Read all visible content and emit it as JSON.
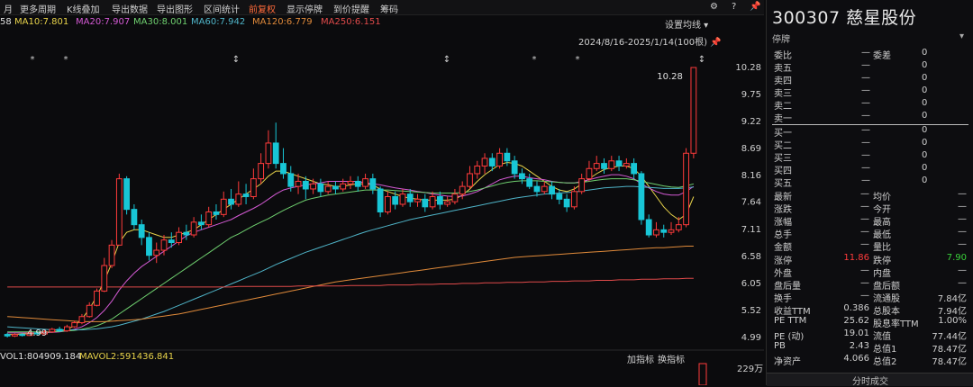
{
  "toolbar": {
    "items": [
      "月",
      "更多周期",
      "K线叠加",
      "导出数据",
      "导出图形",
      "区间统计",
      "前复权",
      "显示停牌",
      "到价提醒",
      "筹码"
    ],
    "active_index": 6,
    "settings_label": "设置均线",
    "date_range": "2024/8/16-2025/1/14(100根)"
  },
  "ma_labels": [
    {
      "text": "58",
      "color": "#e0e0e0"
    },
    {
      "text": "MA10:7.801",
      "color": "#e8d34a"
    },
    {
      "text": "MA20:7.907",
      "color": "#d45ad4"
    },
    {
      "text": "MA30:8.001",
      "color": "#6fd06f"
    },
    {
      "text": "MA60:7.942",
      "color": "#4fb4c8"
    },
    {
      "text": "MA120:6.779",
      "color": "#e08a3a"
    },
    {
      "text": "MA250:6.151",
      "color": "#e04a4a"
    }
  ],
  "chart_data": {
    "type": "candlestick",
    "y_ticks": [
      "10.28",
      "9.75",
      "9.22",
      "8.69",
      "8.16",
      "7.64",
      "7.11",
      "6.58",
      "6.05",
      "5.52",
      "4.99"
    ],
    "ylim": [
      4.99,
      10.28
    ],
    "high_label": "10.28",
    "low_label": "4.99",
    "candles": [
      [
        5.05,
        5.02,
        5.08,
        4.99
      ],
      [
        5.02,
        5.05,
        5.07,
        5.0
      ],
      [
        5.05,
        5.03,
        5.08,
        5.01
      ],
      [
        5.03,
        5.08,
        5.1,
        5.02
      ],
      [
        5.08,
        5.06,
        5.12,
        5.04
      ],
      [
        5.06,
        5.1,
        5.14,
        5.05
      ],
      [
        5.1,
        5.15,
        5.18,
        5.08
      ],
      [
        5.15,
        5.12,
        5.2,
        5.1
      ],
      [
        5.12,
        5.2,
        5.24,
        5.1
      ],
      [
        5.2,
        5.28,
        5.32,
        5.18
      ],
      [
        5.28,
        5.4,
        5.45,
        5.25
      ],
      [
        5.4,
        5.62,
        5.68,
        5.38
      ],
      [
        5.62,
        5.9,
        5.95,
        5.6
      ],
      [
        5.9,
        6.4,
        6.55,
        5.88
      ],
      [
        6.4,
        6.8,
        6.9,
        6.35
      ],
      [
        6.8,
        8.1,
        8.2,
        6.8
      ],
      [
        8.1,
        7.5,
        8.15,
        7.4
      ],
      [
        7.5,
        7.2,
        7.6,
        7.1
      ],
      [
        7.2,
        6.95,
        7.3,
        6.8
      ],
      [
        6.95,
        6.6,
        7.05,
        6.5
      ],
      [
        6.6,
        6.7,
        6.85,
        6.45
      ],
      [
        6.7,
        6.9,
        7.0,
        6.6
      ],
      [
        6.9,
        6.85,
        7.05,
        6.75
      ],
      [
        6.85,
        7.05,
        7.15,
        6.8
      ],
      [
        7.05,
        7.0,
        7.2,
        6.9
      ],
      [
        7.0,
        7.25,
        7.35,
        6.95
      ],
      [
        7.25,
        7.2,
        7.4,
        7.1
      ],
      [
        7.2,
        7.45,
        7.55,
        7.15
      ],
      [
        7.45,
        7.4,
        7.6,
        7.3
      ],
      [
        7.4,
        7.7,
        7.85,
        7.35
      ],
      [
        7.7,
        7.6,
        7.9,
        7.5
      ],
      [
        7.6,
        7.8,
        8.05,
        7.55
      ],
      [
        7.8,
        7.75,
        8.0,
        7.6
      ],
      [
        7.75,
        8.1,
        8.3,
        7.7
      ],
      [
        8.1,
        8.4,
        8.6,
        8.0
      ],
      [
        8.4,
        8.8,
        9.05,
        8.3
      ],
      [
        8.8,
        8.4,
        9.2,
        8.3
      ],
      [
        8.4,
        8.2,
        8.7,
        8.1
      ],
      [
        8.2,
        7.95,
        8.35,
        7.85
      ],
      [
        7.95,
        8.05,
        8.2,
        7.8
      ],
      [
        8.05,
        7.9,
        8.15,
        7.7
      ],
      [
        7.9,
        8.0,
        8.1,
        7.8
      ],
      [
        8.0,
        7.85,
        8.1,
        7.75
      ],
      [
        7.85,
        7.95,
        8.05,
        7.8
      ],
      [
        7.95,
        7.9,
        8.05,
        7.8
      ],
      [
        7.9,
        8.0,
        8.1,
        7.85
      ],
      [
        8.0,
        8.05,
        8.15,
        7.9
      ],
      [
        8.05,
        7.95,
        8.15,
        7.85
      ],
      [
        7.95,
        8.1,
        8.2,
        7.9
      ],
      [
        8.1,
        7.9,
        8.2,
        7.8
      ],
      [
        7.9,
        7.45,
        7.95,
        7.35
      ],
      [
        7.45,
        7.75,
        7.85,
        7.4
      ],
      [
        7.75,
        7.6,
        7.85,
        7.5
      ],
      [
        7.6,
        7.8,
        7.9,
        7.55
      ],
      [
        7.8,
        7.65,
        7.9,
        7.55
      ],
      [
        7.65,
        7.7,
        7.8,
        7.55
      ],
      [
        7.7,
        7.55,
        7.8,
        7.45
      ],
      [
        7.55,
        7.75,
        7.85,
        7.5
      ],
      [
        7.75,
        7.6,
        7.85,
        7.5
      ],
      [
        7.6,
        7.65,
        7.75,
        7.55
      ],
      [
        7.65,
        7.8,
        7.9,
        7.6
      ],
      [
        7.8,
        7.95,
        8.05,
        7.7
      ],
      [
        7.95,
        8.2,
        8.35,
        7.9
      ],
      [
        8.2,
        8.35,
        8.45,
        8.1
      ],
      [
        8.35,
        8.5,
        8.6,
        8.2
      ],
      [
        8.5,
        8.35,
        8.6,
        8.25
      ],
      [
        8.35,
        8.6,
        8.7,
        8.3
      ],
      [
        8.6,
        8.45,
        8.7,
        8.35
      ],
      [
        8.45,
        8.2,
        8.55,
        8.1
      ],
      [
        8.2,
        8.1,
        8.3,
        8.0
      ],
      [
        8.1,
        7.95,
        8.2,
        7.9
      ],
      [
        7.95,
        7.85,
        8.05,
        7.75
      ],
      [
        7.85,
        7.95,
        8.05,
        7.8
      ],
      [
        7.95,
        7.8,
        8.05,
        7.7
      ],
      [
        7.8,
        7.7,
        7.9,
        7.6
      ],
      [
        7.7,
        7.55,
        7.8,
        7.45
      ],
      [
        7.55,
        7.85,
        7.95,
        7.5
      ],
      [
        7.85,
        8.1,
        8.2,
        7.8
      ],
      [
        8.1,
        8.3,
        8.45,
        8.05
      ],
      [
        8.3,
        8.4,
        8.55,
        8.25
      ],
      [
        8.4,
        8.3,
        8.5,
        8.2
      ],
      [
        8.3,
        8.45,
        8.55,
        8.25
      ],
      [
        8.45,
        8.35,
        8.55,
        8.25
      ],
      [
        8.35,
        8.4,
        8.5,
        8.3
      ],
      [
        8.4,
        8.2,
        8.5,
        8.1
      ],
      [
        8.2,
        7.3,
        8.25,
        7.2
      ],
      [
        7.3,
        7.0,
        7.4,
        6.95
      ],
      [
        7.0,
        7.1,
        7.25,
        6.95
      ],
      [
        7.1,
        7.05,
        7.2,
        6.95
      ],
      [
        7.05,
        7.1,
        7.25,
        7.0
      ],
      [
        7.1,
        7.2,
        7.35,
        7.05
      ],
      [
        7.2,
        8.6,
        8.7,
        7.15
      ],
      [
        8.6,
        10.28,
        10.28,
        8.5
      ]
    ]
  },
  "ma_lines": [
    {
      "color": "#e8d34a",
      "values": [
        5.05,
        5.05,
        5.06,
        5.06,
        5.07,
        5.08,
        5.1,
        5.12,
        5.15,
        5.22,
        5.35,
        5.55,
        5.8,
        6.1,
        6.45,
        6.85,
        7.05,
        7.1,
        7.1,
        7.05,
        7.0,
        6.95,
        6.95,
        7.0,
        7.05,
        7.1,
        7.2,
        7.3,
        7.4,
        7.5,
        7.6,
        7.7,
        7.8,
        7.9,
        8.0,
        8.15,
        8.25,
        8.25,
        8.2,
        8.15,
        8.1,
        8.05,
        8.0,
        7.98,
        7.95,
        7.95,
        7.98,
        8.0,
        8.0,
        7.98,
        7.9,
        7.85,
        7.8,
        7.75,
        7.72,
        7.7,
        7.68,
        7.68,
        7.68,
        7.68,
        7.7,
        7.78,
        7.9,
        8.05,
        8.18,
        8.28,
        8.38,
        8.42,
        8.4,
        8.35,
        8.25,
        8.15,
        8.05,
        7.95,
        7.88,
        7.85,
        7.9,
        8.0,
        8.1,
        8.2,
        8.28,
        8.32,
        8.35,
        8.35,
        8.3,
        8.15,
        7.95,
        7.75,
        7.55,
        7.4,
        7.3,
        7.4,
        7.75
      ]
    },
    {
      "color": "#d45ad4",
      "values": [
        5.08,
        5.08,
        5.08,
        5.08,
        5.08,
        5.09,
        5.09,
        5.1,
        5.12,
        5.15,
        5.2,
        5.28,
        5.38,
        5.52,
        5.7,
        5.92,
        6.1,
        6.25,
        6.38,
        6.48,
        6.58,
        6.68,
        6.78,
        6.88,
        6.98,
        7.05,
        7.1,
        7.15,
        7.2,
        7.25,
        7.3,
        7.38,
        7.45,
        7.52,
        7.6,
        7.7,
        7.8,
        7.88,
        7.92,
        7.95,
        7.98,
        8.0,
        8.02,
        8.05,
        8.05,
        8.05,
        8.05,
        8.05,
        8.02,
        8.0,
        7.98,
        7.95,
        7.92,
        7.9,
        7.88,
        7.85,
        7.83,
        7.8,
        7.78,
        7.76,
        7.75,
        7.76,
        7.8,
        7.85,
        7.92,
        8.0,
        8.08,
        8.12,
        8.15,
        8.15,
        8.12,
        8.1,
        8.08,
        8.05,
        8.03,
        8.02,
        8.02,
        8.05,
        8.08,
        8.12,
        8.15,
        8.18,
        8.18,
        8.15,
        8.1,
        8.0,
        7.92,
        7.85,
        7.8,
        7.78,
        7.78,
        7.85,
        7.95
      ]
    },
    {
      "color": "#6fd06f",
      "values": [
        5.1,
        5.1,
        5.1,
        5.1,
        5.1,
        5.1,
        5.1,
        5.11,
        5.12,
        5.13,
        5.15,
        5.18,
        5.22,
        5.28,
        5.35,
        5.45,
        5.55,
        5.65,
        5.75,
        5.85,
        5.95,
        6.05,
        6.15,
        6.25,
        6.35,
        6.45,
        6.55,
        6.65,
        6.75,
        6.85,
        6.95,
        7.02,
        7.1,
        7.18,
        7.25,
        7.32,
        7.4,
        7.48,
        7.55,
        7.62,
        7.68,
        7.72,
        7.75,
        7.78,
        7.8,
        7.82,
        7.84,
        7.86,
        7.88,
        7.88,
        7.88,
        7.88,
        7.87,
        7.86,
        7.85,
        7.84,
        7.83,
        7.82,
        7.82,
        7.82,
        7.82,
        7.83,
        7.85,
        7.88,
        7.92,
        7.96,
        8.0,
        8.03,
        8.05,
        8.06,
        8.06,
        8.06,
        8.05,
        8.04,
        8.03,
        8.02,
        8.02,
        8.03,
        8.05,
        8.07,
        8.09,
        8.1,
        8.1,
        8.1,
        8.08,
        8.05,
        8.02,
        7.99,
        7.96,
        7.94,
        7.93,
        7.96,
        8.0
      ]
    },
    {
      "color": "#4fb4c8",
      "values": [
        5.2,
        5.19,
        5.18,
        5.17,
        5.16,
        5.15,
        5.14,
        5.14,
        5.14,
        5.14,
        5.14,
        5.15,
        5.16,
        5.18,
        5.2,
        5.23,
        5.27,
        5.31,
        5.35,
        5.4,
        5.45,
        5.5,
        5.56,
        5.62,
        5.68,
        5.74,
        5.8,
        5.86,
        5.92,
        5.98,
        6.04,
        6.1,
        6.16,
        6.22,
        6.28,
        6.35,
        6.42,
        6.48,
        6.54,
        6.6,
        6.66,
        6.71,
        6.76,
        6.81,
        6.86,
        6.91,
        6.96,
        7.01,
        7.06,
        7.1,
        7.14,
        7.18,
        7.22,
        7.26,
        7.3,
        7.33,
        7.36,
        7.39,
        7.42,
        7.45,
        7.48,
        7.51,
        7.54,
        7.57,
        7.6,
        7.63,
        7.66,
        7.69,
        7.72,
        7.74,
        7.76,
        7.78,
        7.8,
        7.81,
        7.82,
        7.83,
        7.84,
        7.86,
        7.88,
        7.9,
        7.92,
        7.93,
        7.94,
        7.95,
        7.95,
        7.94,
        7.93,
        7.92,
        7.91,
        7.91,
        7.91,
        7.92,
        7.94
      ]
    },
    {
      "color": "#e08a3a",
      "values": [
        5.4,
        5.39,
        5.38,
        5.37,
        5.36,
        5.35,
        5.34,
        5.33,
        5.32,
        5.31,
        5.3,
        5.3,
        5.3,
        5.3,
        5.31,
        5.32,
        5.33,
        5.34,
        5.35,
        5.37,
        5.39,
        5.41,
        5.43,
        5.45,
        5.48,
        5.51,
        5.54,
        5.57,
        5.6,
        5.63,
        5.66,
        5.69,
        5.72,
        5.75,
        5.78,
        5.81,
        5.84,
        5.87,
        5.9,
        5.93,
        5.96,
        5.99,
        6.02,
        6.05,
        6.08,
        6.1,
        6.12,
        6.14,
        6.16,
        6.18,
        6.2,
        6.22,
        6.24,
        6.26,
        6.28,
        6.3,
        6.32,
        6.34,
        6.36,
        6.38,
        6.4,
        6.42,
        6.44,
        6.46,
        6.48,
        6.5,
        6.52,
        6.54,
        6.56,
        6.57,
        6.58,
        6.59,
        6.6,
        6.61,
        6.62,
        6.63,
        6.64,
        6.65,
        6.66,
        6.67,
        6.68,
        6.69,
        6.7,
        6.71,
        6.72,
        6.73,
        6.74,
        6.75,
        6.75,
        6.76,
        6.77,
        6.78,
        6.78
      ]
    },
    {
      "color": "#e04a4a",
      "values": [
        5.98,
        5.98,
        5.98,
        5.98,
        5.98,
        5.98,
        5.98,
        5.98,
        5.98,
        5.98,
        5.98,
        5.98,
        5.98,
        5.98,
        5.98,
        5.98,
        5.98,
        5.98,
        5.98,
        5.98,
        5.98,
        5.98,
        5.98,
        5.98,
        5.98,
        5.98,
        5.98,
        5.98,
        5.98,
        5.98,
        5.98,
        5.99,
        5.99,
        5.99,
        5.99,
        5.99,
        5.99,
        5.99,
        5.99,
        6.0,
        6.0,
        6.0,
        6.0,
        6.0,
        6.0,
        6.0,
        6.01,
        6.01,
        6.01,
        6.01,
        6.01,
        6.02,
        6.02,
        6.02,
        6.02,
        6.03,
        6.03,
        6.03,
        6.04,
        6.04,
        6.04,
        6.05,
        6.05,
        6.05,
        6.06,
        6.06,
        6.06,
        6.07,
        6.07,
        6.07,
        6.08,
        6.08,
        6.08,
        6.09,
        6.09,
        6.09,
        6.1,
        6.1,
        6.1,
        6.11,
        6.11,
        6.11,
        6.12,
        6.12,
        6.12,
        6.13,
        6.13,
        6.13,
        6.14,
        6.14,
        6.14,
        6.15,
        6.15
      ]
    }
  ],
  "markers": {
    "star_label": "*",
    "arrow_label": "↕"
  },
  "volume": {
    "mavol1": "VOL1:804909.184",
    "mavol2": "MAVOL2:591436.841",
    "add_label": "加指标",
    "swap_label": "换指标",
    "scale": "229万"
  },
  "panel": {
    "title": "300307 慈星股份",
    "status": "停牌",
    "wei_bi_label": "委比",
    "wei_bi_value": "—",
    "wei_cha_label": "委差",
    "wei_cha_value": "0",
    "sell_levels": [
      {
        "label": "卖五",
        "price": "—",
        "vol": "0"
      },
      {
        "label": "卖四",
        "price": "—",
        "vol": "0"
      },
      {
        "label": "卖三",
        "price": "—",
        "vol": "0"
      },
      {
        "label": "卖二",
        "price": "—",
        "vol": "0"
      },
      {
        "label": "卖一",
        "price": "—",
        "vol": "0"
      }
    ],
    "buy_levels": [
      {
        "label": "买一",
        "price": "—",
        "vol": "0"
      },
      {
        "label": "买二",
        "price": "—",
        "vol": "0"
      },
      {
        "label": "买三",
        "price": "—",
        "vol": "0"
      },
      {
        "label": "买四",
        "price": "—",
        "vol": "0"
      },
      {
        "label": "买五",
        "price": "—",
        "vol": "0"
      }
    ],
    "stats": [
      {
        "l1": "最新",
        "v1": "—",
        "l2": "均价",
        "v2": "—",
        "c1": "",
        "c2": ""
      },
      {
        "l1": "涨跌",
        "v1": "—",
        "l2": "今开",
        "v2": "—",
        "c1": "",
        "c2": ""
      },
      {
        "l1": "涨幅",
        "v1": "—",
        "l2": "最高",
        "v2": "—",
        "c1": "",
        "c2": ""
      },
      {
        "l1": "总手",
        "v1": "—",
        "l2": "最低",
        "v2": "—",
        "c1": "",
        "c2": ""
      },
      {
        "l1": "金额",
        "v1": "—",
        "l2": "量比",
        "v2": "—",
        "c1": "",
        "c2": ""
      },
      {
        "l1": "涨停",
        "v1": "11.86",
        "l2": "跌停",
        "v2": "7.90",
        "c1": "red",
        "c2": "green"
      },
      {
        "l1": "外盘",
        "v1": "—",
        "l2": "内盘",
        "v2": "—",
        "c1": "",
        "c2": ""
      },
      {
        "l1": "盘后量",
        "v1": "—",
        "l2": "盘后额",
        "v2": "—",
        "c1": "",
        "c2": ""
      },
      {
        "l1": "换手",
        "v1": "—",
        "l2": "流通股",
        "v2": "7.84亿",
        "c1": "",
        "c2": ""
      },
      {
        "l1": "收益TTM",
        "v1": "0.386",
        "l2": "总股本",
        "v2": "7.94亿",
        "c1": "",
        "c2": ""
      },
      {
        "l1": "PE TTM",
        "v1": "25.62",
        "l2": "股息率TTM",
        "v2": "1.00%",
        "c1": "",
        "c2": ""
      },
      {
        "l1": "PE (动)",
        "v1": "19.01",
        "l2": "流值",
        "v2": "77.44亿",
        "c1": "",
        "c2": ""
      },
      {
        "l1": "PB",
        "v1": "2.43",
        "l2": "总值1",
        "v2": "78.47亿",
        "c1": "",
        "c2": ""
      },
      {
        "l1": "净资产",
        "v1": "4.066",
        "l2": "总值2",
        "v2": "78.47亿",
        "c1": "",
        "c2": ""
      }
    ],
    "footer_label": "分时成交"
  },
  "colors": {
    "up": "#ff3b3b",
    "down": "#18c6d6",
    "accent": "#ff6a3a"
  }
}
